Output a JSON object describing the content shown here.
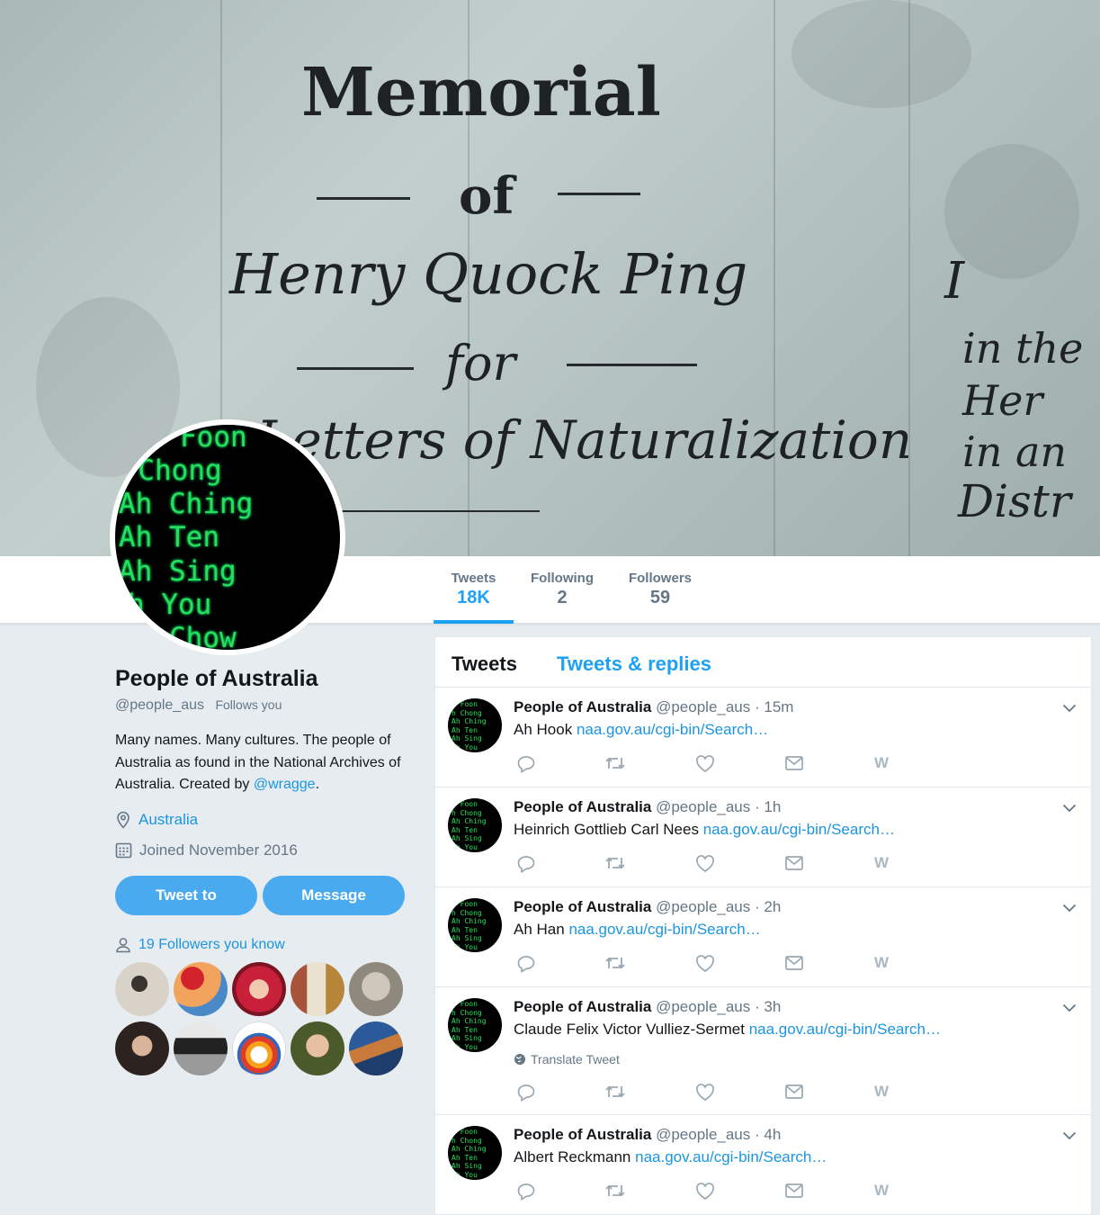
{
  "banner": {
    "lines": [
      "Memorial",
      "of",
      "Henry Quock Ping",
      "for",
      "Letters of Naturalization"
    ],
    "side_lines": [
      "I",
      "in the",
      "Her",
      "in an",
      "Distr"
    ]
  },
  "avatar_lines": [
    "Foon",
    "h Chong",
    "Ah Ching",
    "Ah Ten",
    "Ah Sing",
    "h You",
    "Chow"
  ],
  "stats": [
    {
      "label": "Tweets",
      "value": "18K"
    },
    {
      "label": "Following",
      "value": "2"
    },
    {
      "label": "Followers",
      "value": "59"
    }
  ],
  "profile": {
    "name": "People of Australia",
    "handle": "@people_aus",
    "follows_you": "Follows you",
    "bio_text": "Many names. Many cultures. The people of Australia as found in the National Archives of Australia. Created by",
    "bio_link": "@wragge",
    "bio_end": ".",
    "location": "Australia",
    "joined": "Joined November 2016",
    "tweet_to_label": "Tweet to",
    "message_label": "Message",
    "followers_you_know": "19 Followers you know"
  },
  "timeline": {
    "tab_tweets": "Tweets",
    "tab_replies": "Tweets & replies",
    "tweets": [
      {
        "name": "People of Australia",
        "handle": "@people_aus",
        "time": "· 15m",
        "text": "Ah Hook",
        "link": "naa.gov.au/cgi-bin/Search…",
        "translate": ""
      },
      {
        "name": "People of Australia",
        "handle": "@people_aus",
        "time": "· 1h",
        "text": "Heinrich Gottlieb Carl Nees",
        "link": "naa.gov.au/cgi-bin/Search…",
        "translate": ""
      },
      {
        "name": "People of Australia",
        "handle": "@people_aus",
        "time": "· 2h",
        "text": "Ah Han",
        "link": "naa.gov.au/cgi-bin/Search…",
        "translate": ""
      },
      {
        "name": "People of Australia",
        "handle": "@people_aus",
        "time": "· 3h",
        "text": "Claude Felix Victor Vulliez-Sermet",
        "link": "naa.gov.au/cgi-bin/Search…",
        "translate": "Translate Tweet"
      },
      {
        "name": "People of Australia",
        "handle": "@people_aus",
        "time": "· 4h",
        "text": "Albert Reckmann",
        "link": "naa.gov.au/cgi-bin/Search…",
        "translate": ""
      }
    ],
    "action_w": "W"
  },
  "colors": {
    "accent": "#1da1f2",
    "button": "#4aaaf0",
    "muted": "#657786"
  }
}
